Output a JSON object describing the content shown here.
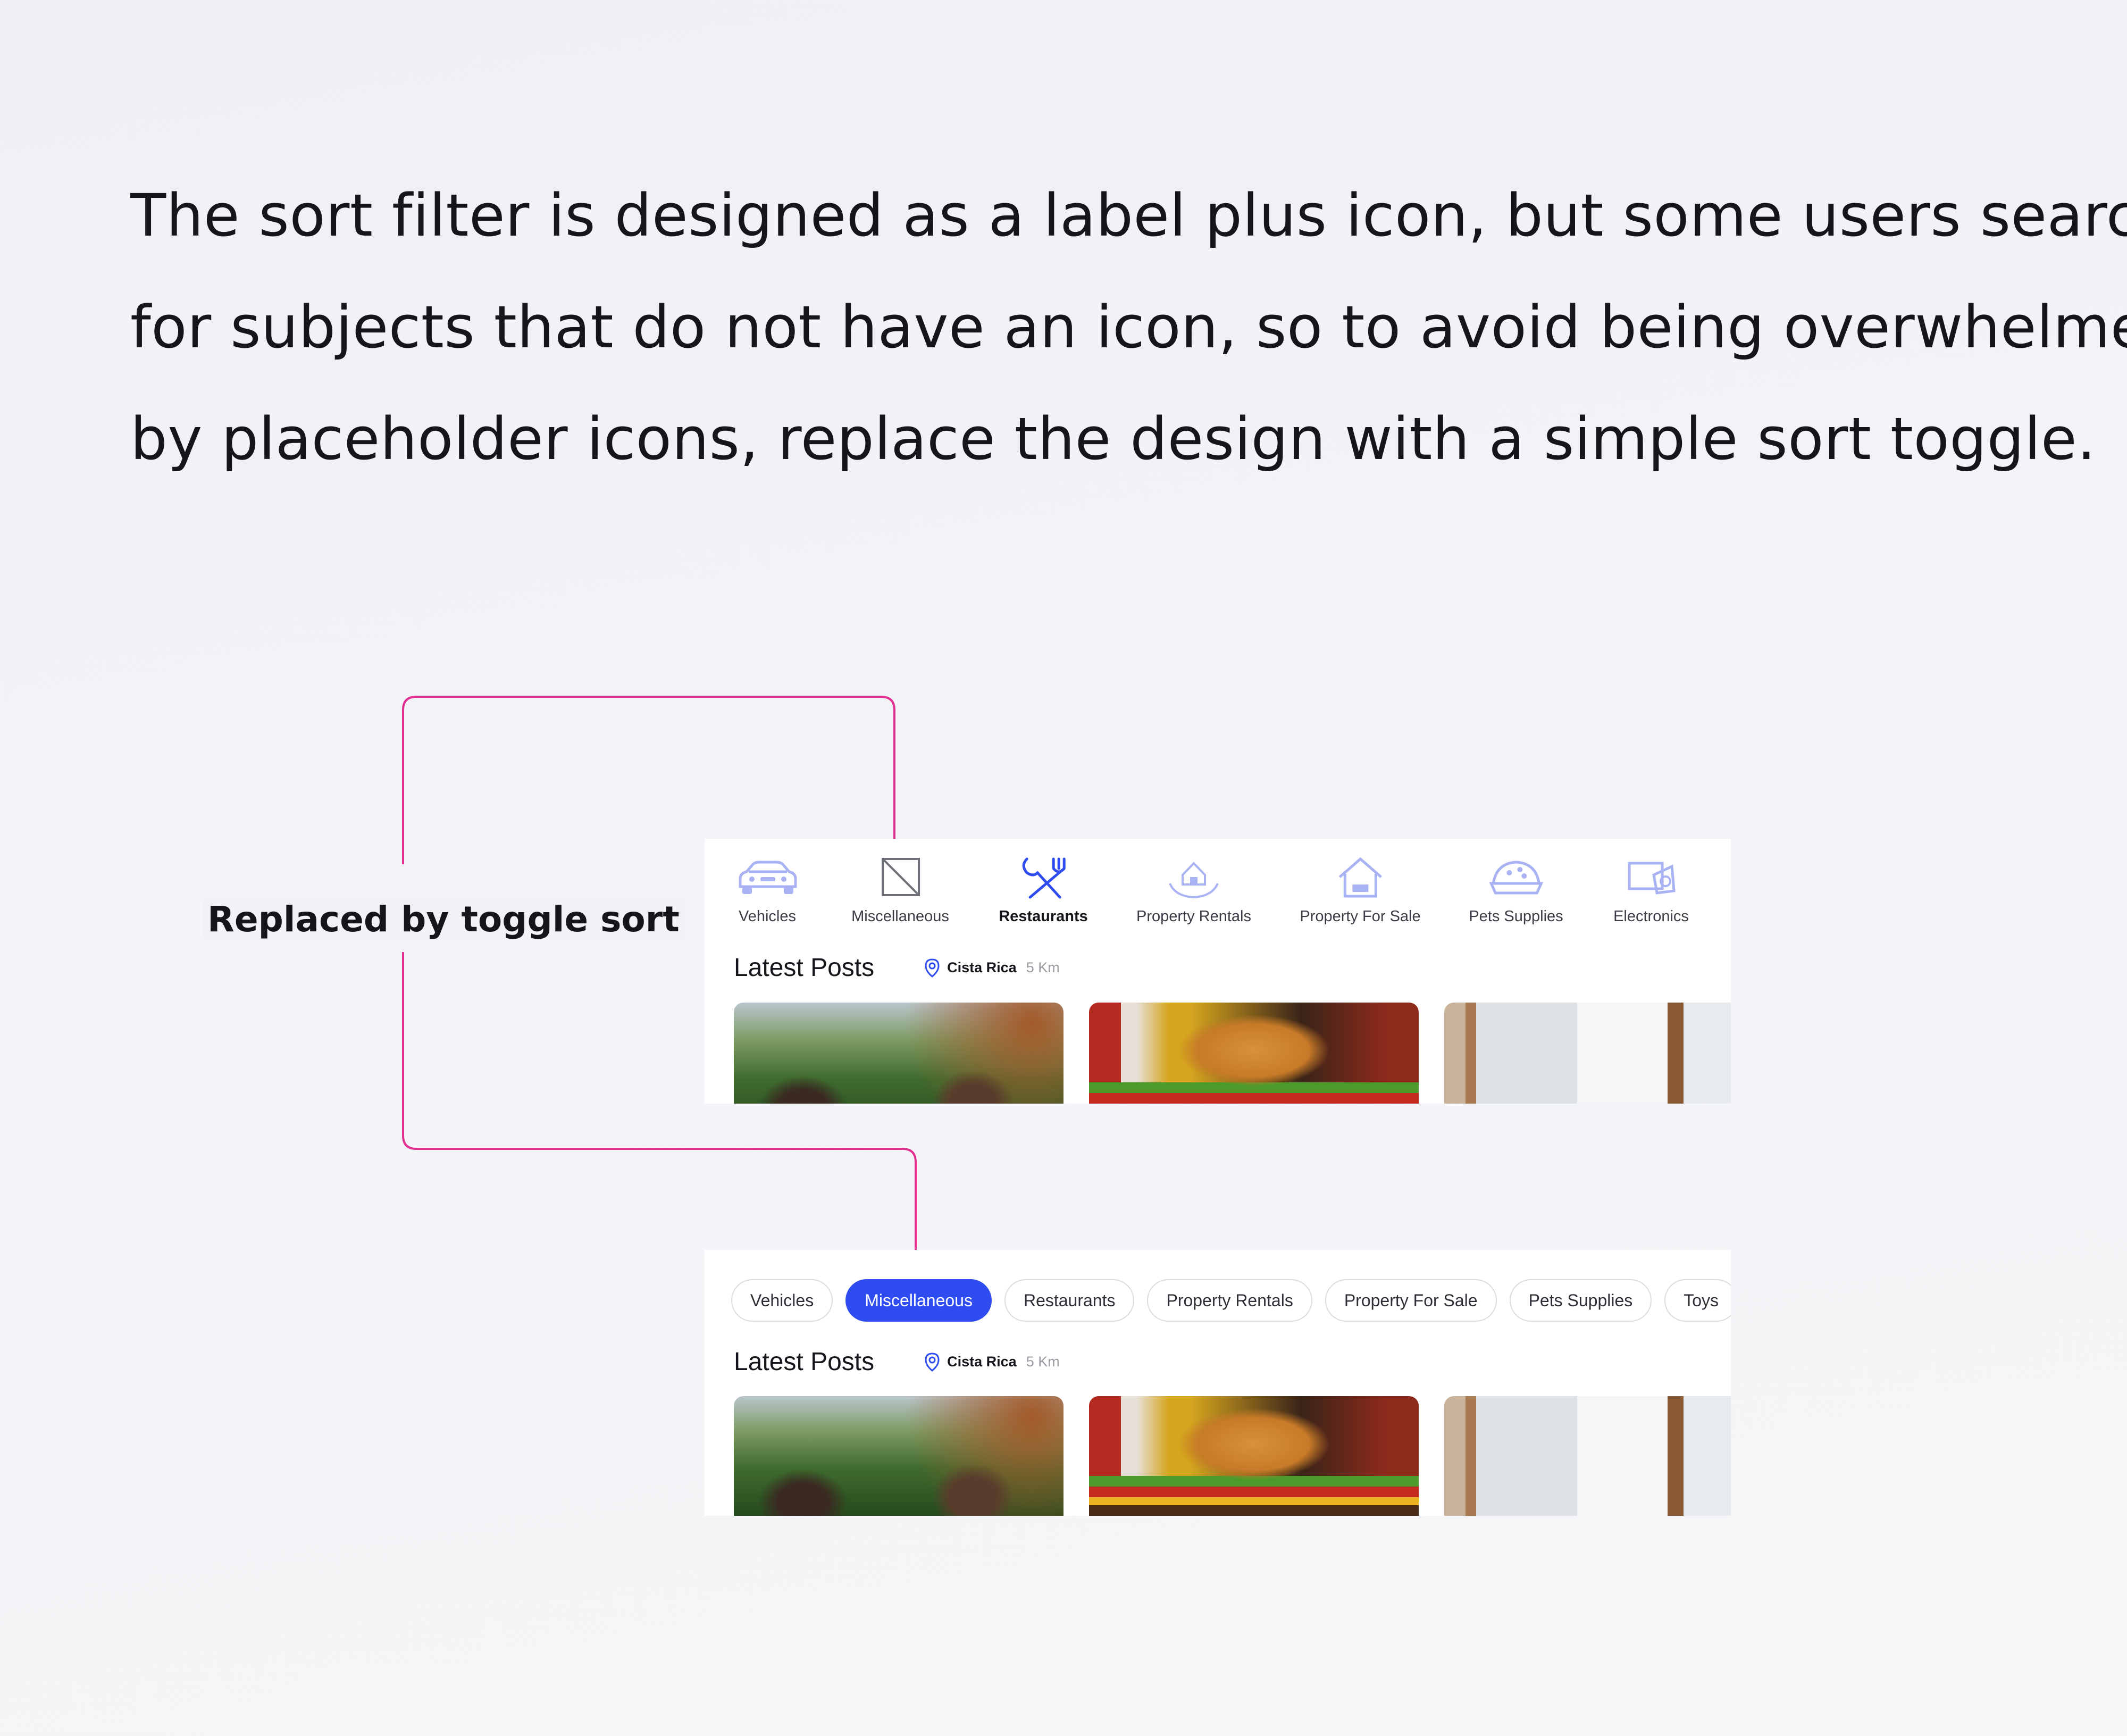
{
  "headline": {
    "line1": "The sort filter is designed as a label plus icon, but some users search",
    "line2": "for subjects that do not have an icon, so to avoid being overwhelmed",
    "line3": "by placeholder icons, replace the design with a simple sort toggle."
  },
  "annotation_label": "Replaced by toggle sort",
  "colors": {
    "accent": "#2f4cf0",
    "connector": "#e02f8e",
    "icon_tint": "#a9b2f3"
  },
  "before": {
    "categories": [
      {
        "label": "Vehicles",
        "icon": "car-icon"
      },
      {
        "label": "Miscellaneous",
        "icon": "placeholder-icon"
      },
      {
        "label": "Restaurants",
        "icon": "fork-knife-icon",
        "active": true
      },
      {
        "label": "Property Rentals",
        "icon": "house-hand-icon"
      },
      {
        "label": "Property For Sale",
        "icon": "house-sale-icon"
      },
      {
        "label": "Pets Supplies",
        "icon": "pet-bowl-icon"
      },
      {
        "label": "Electronics",
        "icon": "electronics-icon"
      }
    ],
    "latest_posts": {
      "title": "Latest Posts",
      "location": "Cista Rica",
      "distance": "5 Km"
    },
    "thumbnails": [
      "people-dining-outdoors-photo",
      "burger-photo",
      "restaurant-interior-photo"
    ]
  },
  "after": {
    "chips": [
      {
        "label": "Vehicles"
      },
      {
        "label": "Miscellaneous",
        "active": true
      },
      {
        "label": "Restaurants"
      },
      {
        "label": "Property Rentals"
      },
      {
        "label": "Property For Sale"
      },
      {
        "label": "Pets Supplies"
      },
      {
        "label": "Toys"
      }
    ],
    "latest_posts": {
      "title": "Latest Posts",
      "location": "Cista Rica",
      "distance": "5 Km"
    },
    "thumbnails": [
      "people-dining-outdoors-photo",
      "burger-photo",
      "restaurant-interior-photo"
    ]
  }
}
